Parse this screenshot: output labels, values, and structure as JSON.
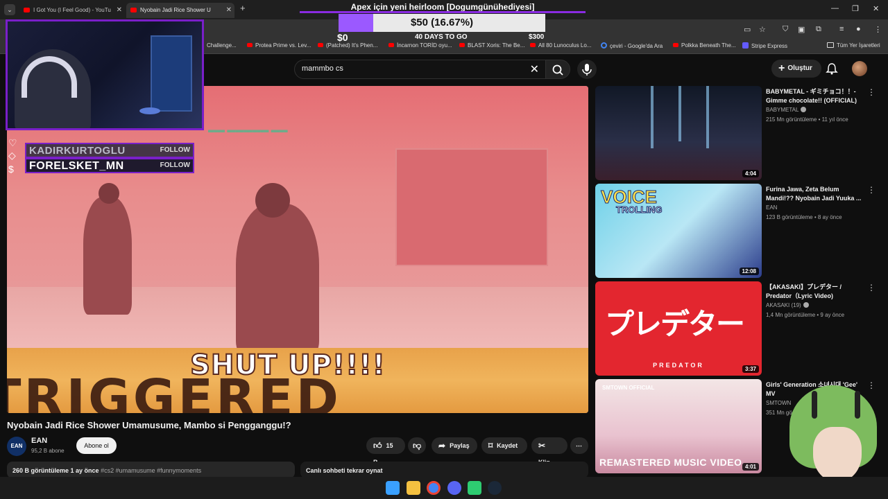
{
  "browser": {
    "tabs": [
      {
        "title": "I Got You (I Feel Good) - YouTu",
        "active": false
      },
      {
        "title": "Nyobain Jadi Rice Shower U",
        "active": true
      }
    ],
    "bookmarks": [
      "Challenge...",
      "Protea Prime vs. Lev...",
      "(Patched) It's Phen...",
      "İncarnon TORİD oyu...",
      "BLAST Xoris: The Be...",
      "All 80 Lunoculus Lo...",
      "çeviri - Google'da Ara",
      "Polkka Beneath The...",
      "Stripe Express",
      "Tüm Yer İşaretleri"
    ]
  },
  "overlay": {
    "donation_title": "Apex için yeni heirloom [Dogumgünühediyesi]",
    "donation_amount": "$50 (16.67%)",
    "donation_progress": 0.1667,
    "donation_min": "$0",
    "donation_days": "40 DAYS TO GO",
    "donation_max": "$300",
    "followers": [
      {
        "name": "KADIRKURTOGLU",
        "button": "FOLLOW"
      },
      {
        "name": "FORELSKET_MN",
        "button": "FOLLOW"
      }
    ]
  },
  "youtube": {
    "search_value": "mammbo cs",
    "create_label": "Oluştur",
    "video": {
      "overlay_top": "SHUT UP!!!!",
      "overlay_bottom": "TRIGGERED",
      "title": "Nyobain Jadi Rice Shower Umamusume, Mambo si Pengganggu!?",
      "channel": "EAN",
      "channel_avatar": "EAN",
      "subscribers": "95,2 B abone",
      "subscribe_label": "Abone ol",
      "likes": "15 B",
      "share_label": "Paylaş",
      "save_label": "Kaydet",
      "clip_label": "Klip",
      "views_date": "260 B görüntüleme  1 ay önce",
      "tags": "#cs2 #umamusume #funnymoments",
      "chat_replay": "Canlı sohbeti tekrar oynat"
    },
    "recommendations": [
      {
        "title": "BABYMETAL - ギミチョコ！！- Gimme chocolate!! (OFFICIAL)",
        "channel": "BABYMETAL",
        "meta": "215 Mn görüntüleme • 11 yıl önce",
        "duration": "4:04"
      },
      {
        "title": "Furina Jawa, Zeta Belum Mandi!?? Nyobain Jadi Yuuka ...",
        "channel": "EAN",
        "meta": "123 B görüntüleme • 8 ay önce",
        "duration": "12:08",
        "thumb_text_1": "VOICE",
        "thumb_text_2": "TROLLING"
      },
      {
        "title": "【AKASAKI】プレデター / Predator（Lyric Video)",
        "channel": "AKASAKI (19)",
        "meta": "1,4 Mn görüntüleme • 9 ay önce",
        "duration": "3:37",
        "thumb_text_1": "プレデター",
        "thumb_text_2": "PREDATOR"
      },
      {
        "title": "Girls' Generation 소녀시대 'Gee' MV",
        "channel": "SMTOWN",
        "meta": "351 Mn gö",
        "duration": "4:01",
        "thumb_text_1": "SMTOWN OFFICIAL",
        "thumb_text_2": "REMASTERED MUSIC VIDEO"
      }
    ]
  },
  "colors": {
    "accent_purple": "#7a1fc9",
    "yt_red": "#ff0000",
    "bg": "#0f0f0f"
  }
}
